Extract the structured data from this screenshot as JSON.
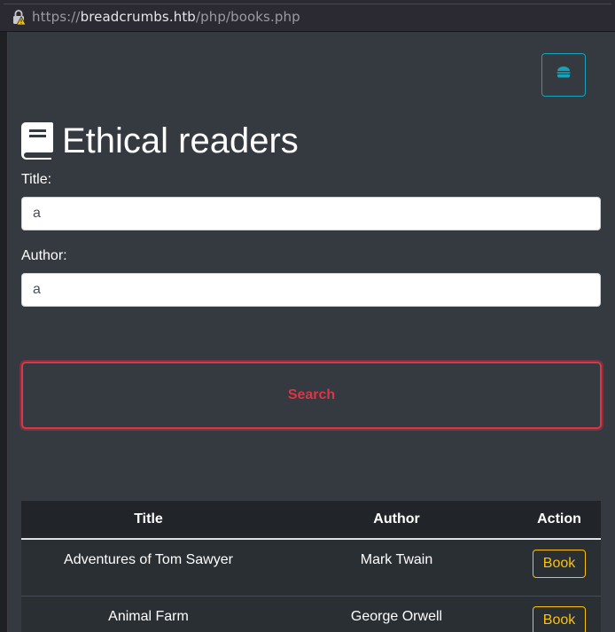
{
  "browser": {
    "url_scheme": "https://",
    "url_host": "breadcrumbs.htb",
    "url_path": "/php/books.php"
  },
  "header": {
    "title": "Ethical readers",
    "icon": "book-icon",
    "menu_icon": "hamburger-icon"
  },
  "form": {
    "title_label": "Title:",
    "title_value": "a",
    "author_label": "Author:",
    "author_value": "a",
    "search_label": "Search"
  },
  "table": {
    "columns": [
      "Title",
      "Author",
      "Action"
    ],
    "rows": [
      {
        "title": "Adventures of Tom Sawyer",
        "author": "Mark Twain",
        "action": "Book"
      },
      {
        "title": "Animal Farm",
        "author": "George Orwell",
        "action": "Book"
      }
    ]
  },
  "colors": {
    "background": "#343a40",
    "accent_info": "#17a2b8",
    "accent_danger": "#dc3545",
    "accent_warning": "#ffc107"
  }
}
